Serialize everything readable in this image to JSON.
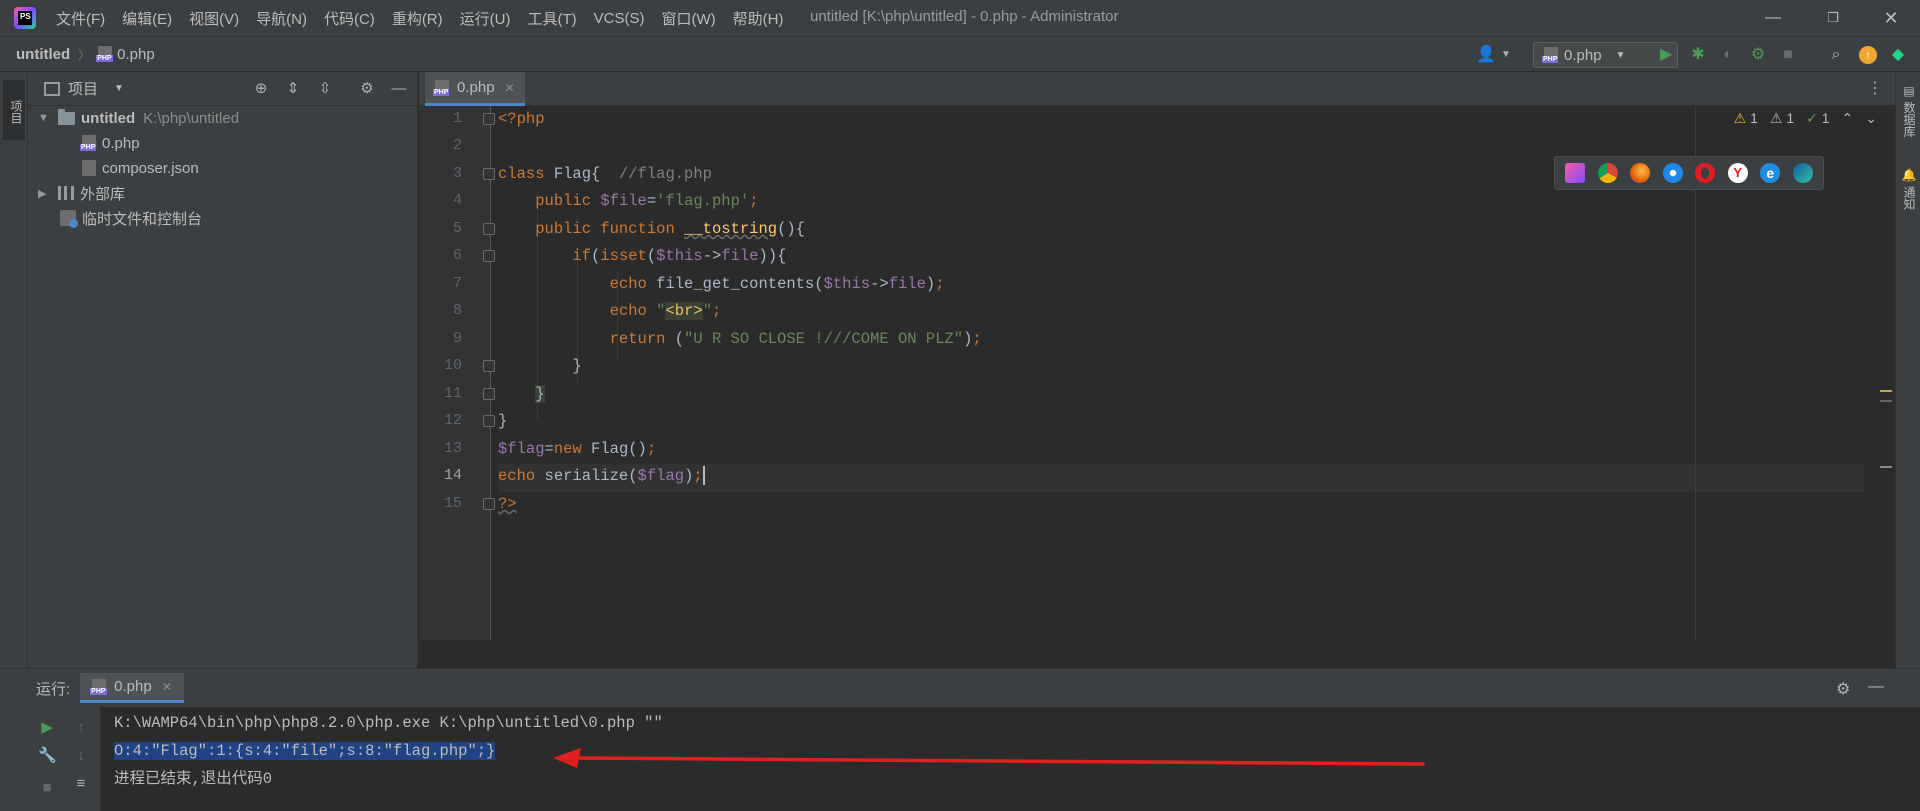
{
  "window": {
    "title": "untitled [K:\\php\\untitled] - 0.php - Administrator",
    "logo_text": "PS"
  },
  "menu": [
    "文件(F)",
    "编辑(E)",
    "视图(V)",
    "导航(N)",
    "代码(C)",
    "重构(R)",
    "运行(U)",
    "工具(T)",
    "VCS(S)",
    "窗口(W)",
    "帮助(H)"
  ],
  "breadcrumb": {
    "project": "untitled",
    "file": "0.php"
  },
  "run_config": {
    "name": "0.php"
  },
  "left_stripe": {
    "project_tab": "项目"
  },
  "project_panel": {
    "title": "项目",
    "tree": {
      "root": {
        "name": "untitled",
        "path": "K:\\php\\untitled"
      },
      "children": [
        "0.php",
        "composer.json"
      ],
      "external_libraries": "外部库",
      "scratches": "临时文件和控制台"
    }
  },
  "editor": {
    "tab": "0.php",
    "line_numbers": [
      "1",
      "2",
      "3",
      "4",
      "5",
      "6",
      "7",
      "8",
      "9",
      "10",
      "11",
      "12",
      "13",
      "14",
      "15"
    ],
    "current_line": 14,
    "inspections": {
      "warnings": "1",
      "weak_warnings": "1",
      "typos": "1"
    }
  },
  "right_stripe": {
    "database_tab": "数据库",
    "notifications_tab": "通知"
  },
  "run_panel": {
    "label": "运行:",
    "tab": "0.php",
    "console": {
      "command": "K:\\WAMP64\\bin\\php\\php8.2.0\\php.exe K:\\php\\untitled\\0.php \"\"",
      "output": "O:4:\"Flag\":1:{s:4:\"file\";s:8:\"flag.php\";}",
      "exit": "进程已结束,退出代码0"
    }
  },
  "colors": {
    "keyword": "#cc7832",
    "variable": "#9876aa",
    "string": "#6a8759",
    "comment": "#808080",
    "function": "#ffc66d",
    "selection": "#214283",
    "accent": "#4a88c7",
    "annotation_arrow": "#e0201e"
  }
}
